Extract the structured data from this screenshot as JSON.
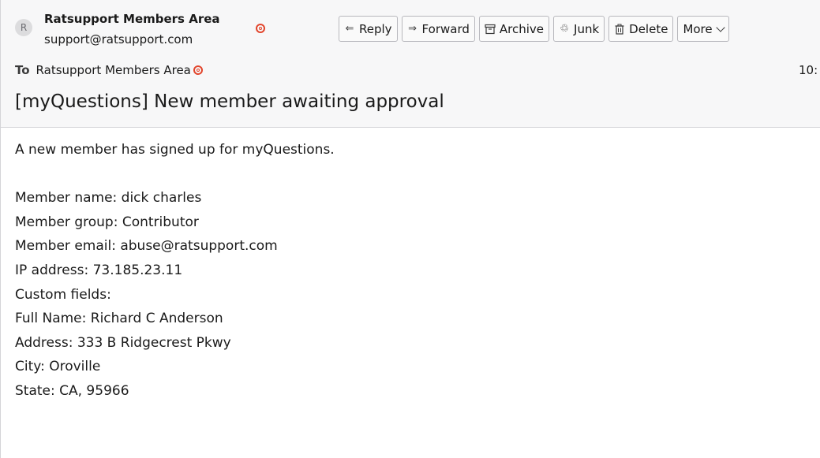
{
  "sender": {
    "avatar_letter": "R",
    "name": "Ratsupport Members Area",
    "email": "support@ratsupport.com"
  },
  "toolbar": {
    "reply_label": "Reply",
    "forward_label": "Forward",
    "archive_label": "Archive",
    "junk_label": "Junk",
    "delete_label": "Delete",
    "more_label": "More"
  },
  "recipient": {
    "label": "To",
    "name": "Ratsupport Members Area"
  },
  "time": "10:",
  "subject": "[myQuestions] New member awaiting approval",
  "body": {
    "lines": [
      "A new member has signed up for myQuestions.",
      "",
      "Member name: dick charles",
      "Member group: Contributor",
      "Member email: abuse@ratsupport.com",
      "IP address: 73.185.23.11",
      "Custom fields:",
      "Full Name: Richard C Anderson",
      "Address: 333 B Ridgecrest Pkwy",
      "City: Oroville",
      "State: CA, 95966"
    ]
  },
  "colors": {
    "header_bg": "#f7f7f8",
    "contact_icon": "#e2452c",
    "border": "#d4d4d8"
  }
}
